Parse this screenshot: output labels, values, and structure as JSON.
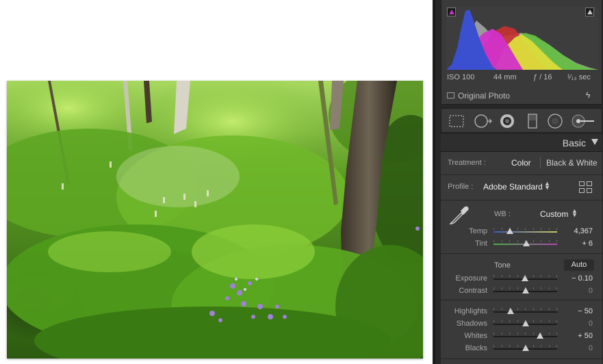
{
  "histogram": {
    "exif": {
      "iso": "ISO 100",
      "focal": "44 mm",
      "aperture": "ƒ / 16",
      "shutter": "¹⁄₁₃ sec"
    },
    "original_photo_label": "Original Photo"
  },
  "tools": [
    "crop-overlay-icon",
    "spot-removal-icon",
    "red-eye-icon",
    "graduated-filter-icon",
    "radial-filter-icon",
    "adjustment-brush-icon"
  ],
  "basic": {
    "title": "Basic",
    "treatment_label": "Treatment :",
    "treatment_color": "Color",
    "treatment_bw": "Black & White",
    "profile_label": "Profile :",
    "profile_value": "Adobe Standard",
    "wb_label": "WB :",
    "wb_value": "Custom",
    "tone_label": "Tone",
    "auto_label": "Auto",
    "sliders": {
      "temp": {
        "label": "Temp",
        "display": "4,367",
        "position": 0.26
      },
      "tint": {
        "label": "Tint",
        "display": "+ 6",
        "position": 0.52
      },
      "exposure": {
        "label": "Exposure",
        "display": "− 0.10",
        "position": 0.49
      },
      "contrast": {
        "label": "Contrast",
        "display": "0",
        "position": 0.5
      },
      "highlights": {
        "label": "Highlights",
        "display": "− 50",
        "position": 0.27
      },
      "shadows": {
        "label": "Shadows",
        "display": "0",
        "position": 0.5
      },
      "whites": {
        "label": "Whites",
        "display": "+ 50",
        "position": 0.73
      },
      "blacks": {
        "label": "Blacks",
        "display": "0",
        "position": 0.5
      }
    }
  },
  "colors": {
    "panel_bg": "#3a3a3a",
    "panel_dark": "#272727",
    "accent_clip": "#c832c8"
  }
}
